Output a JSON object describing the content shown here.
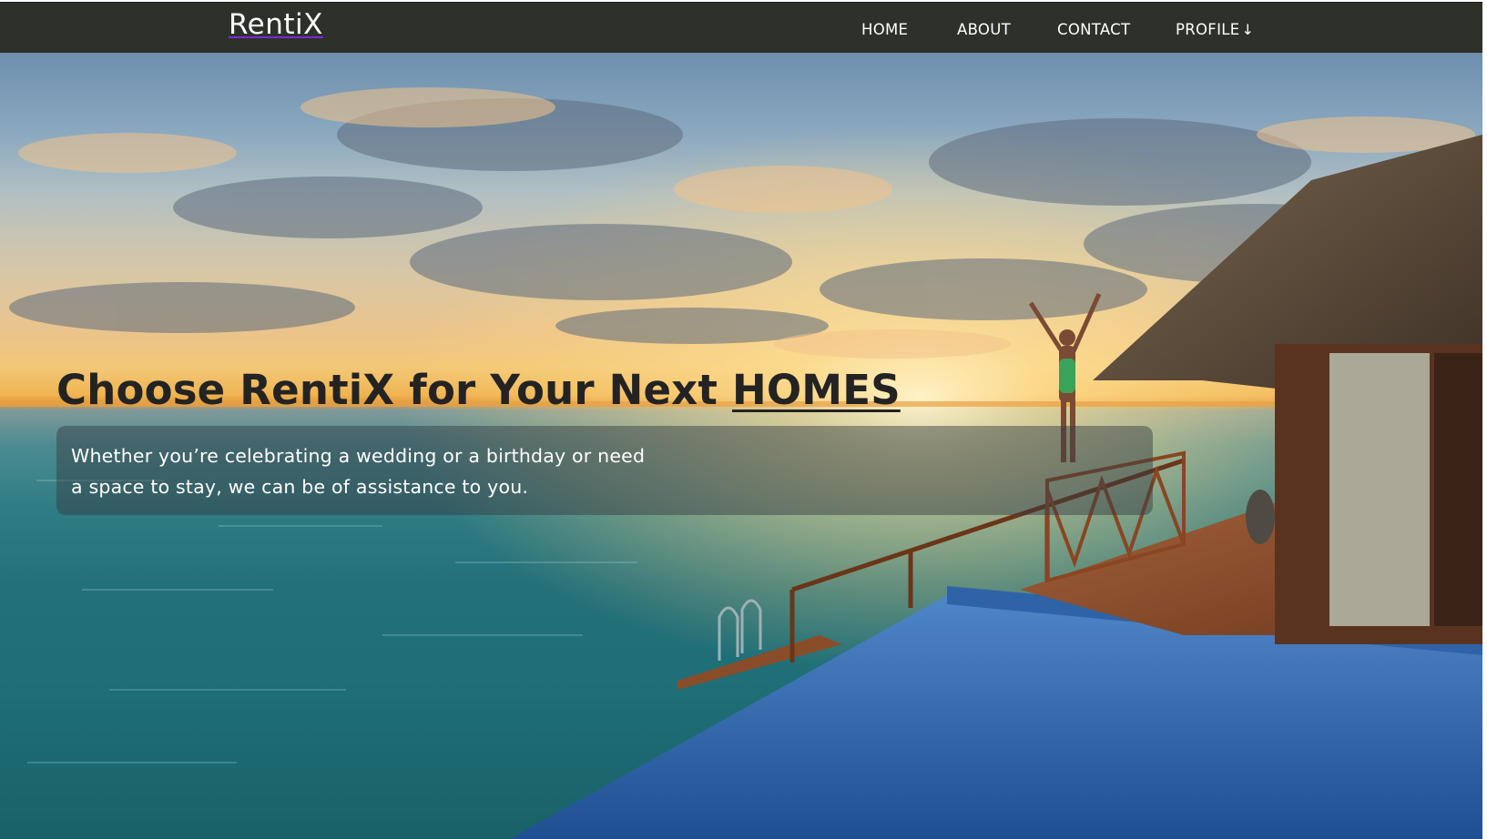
{
  "brand": {
    "name": "RentiX"
  },
  "nav": {
    "home": "HOME",
    "about": "ABOUT",
    "contact": "CONTACT",
    "profile": "PROFILE",
    "profile_arrow": "↓"
  },
  "hero": {
    "headline_prefix": "Choose RentiX for Your Next ",
    "headline_accent": "HOMES",
    "subtext": "Whether you’re celebrating a wedding or a birthday or need a space to stay, we can be of assistance to you."
  },
  "colors": {
    "navbar_bg": "#2d3129",
    "brand_underline": "#7a2bd6",
    "headline_text": "#232323",
    "subbox_bg": "rgba(55,60,66,0.48)"
  },
  "icons": {
    "profile_dropdown": "arrow-down-icon"
  }
}
